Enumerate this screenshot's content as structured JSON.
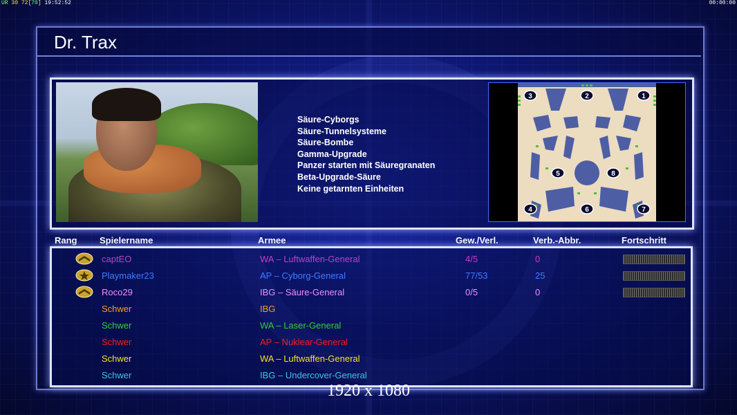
{
  "hud": {
    "fps_a": "UR",
    "fps_b": "30",
    "fps_c": "72[",
    "fps_d": "70",
    "fps_e": "]",
    "time": "19:52:52",
    "clock_right": "00:00:00"
  },
  "title": "Dr. Trax",
  "perks": [
    "Säure-Cyborgs",
    "Säure-Tunnelsysteme",
    "Säure-Bombe",
    "Gamma-Upgrade",
    "Panzer starten mit Säuregranaten",
    "Beta-Upgrade-Säure",
    "Keine getarnten Einheiten"
  ],
  "map_slots": [
    "1",
    "2",
    "3",
    "4",
    "5",
    "6",
    "7",
    "8"
  ],
  "headers": {
    "rank": "Rang",
    "player": "Spielername",
    "army": "Armee",
    "winloss": "Gew./Verl.",
    "disconnects": "Verb.-Abbr.",
    "progress": "Fortschritt"
  },
  "players": [
    {
      "name": "captEO",
      "army": "WA – Luftwaffen-General",
      "winloss": "4/5",
      "disconnects": "0",
      "color": "#c040c8",
      "rank_icon": "chevron-rank-icon",
      "has_stats": true
    },
    {
      "name": "Playmaker23",
      "army": "AP – Cyborg-General",
      "winloss": "77/53",
      "disconnects": "25",
      "color": "#3f7bff",
      "rank_icon": "star-rank-icon",
      "has_stats": true
    },
    {
      "name": "Roco29",
      "army": "IBG – Säure-General",
      "winloss": "0/5",
      "disconnects": "0",
      "color": "#f08cff",
      "rank_icon": "chevron-rank-icon",
      "has_stats": true
    },
    {
      "name": "Schwer",
      "army": "IBG",
      "winloss": "",
      "disconnects": "",
      "color": "#ff9a1a",
      "rank_icon": "",
      "has_stats": false
    },
    {
      "name": "Schwer",
      "army": "WA – Laser-General",
      "winloss": "",
      "disconnects": "",
      "color": "#2fd22f",
      "rank_icon": "",
      "has_stats": false
    },
    {
      "name": "Schwer",
      "army": "AP – Nuklear-General",
      "winloss": "",
      "disconnects": "",
      "color": "#ff1a1a",
      "rank_icon": "",
      "has_stats": false
    },
    {
      "name": "Schwer",
      "army": "WA – Luftwaffen-General",
      "winloss": "",
      "disconnects": "",
      "color": "#f2e51c",
      "rank_icon": "",
      "has_stats": false
    },
    {
      "name": "Schwer",
      "army": "IBG – Undercover-General",
      "winloss": "",
      "disconnects": "",
      "color": "#38c8e6",
      "rank_icon": "",
      "has_stats": false
    }
  ],
  "resolution": "1920 x 1080",
  "colors": {
    "accent": "#dfe4ff",
    "panel_glow": "#8fa0ff"
  }
}
